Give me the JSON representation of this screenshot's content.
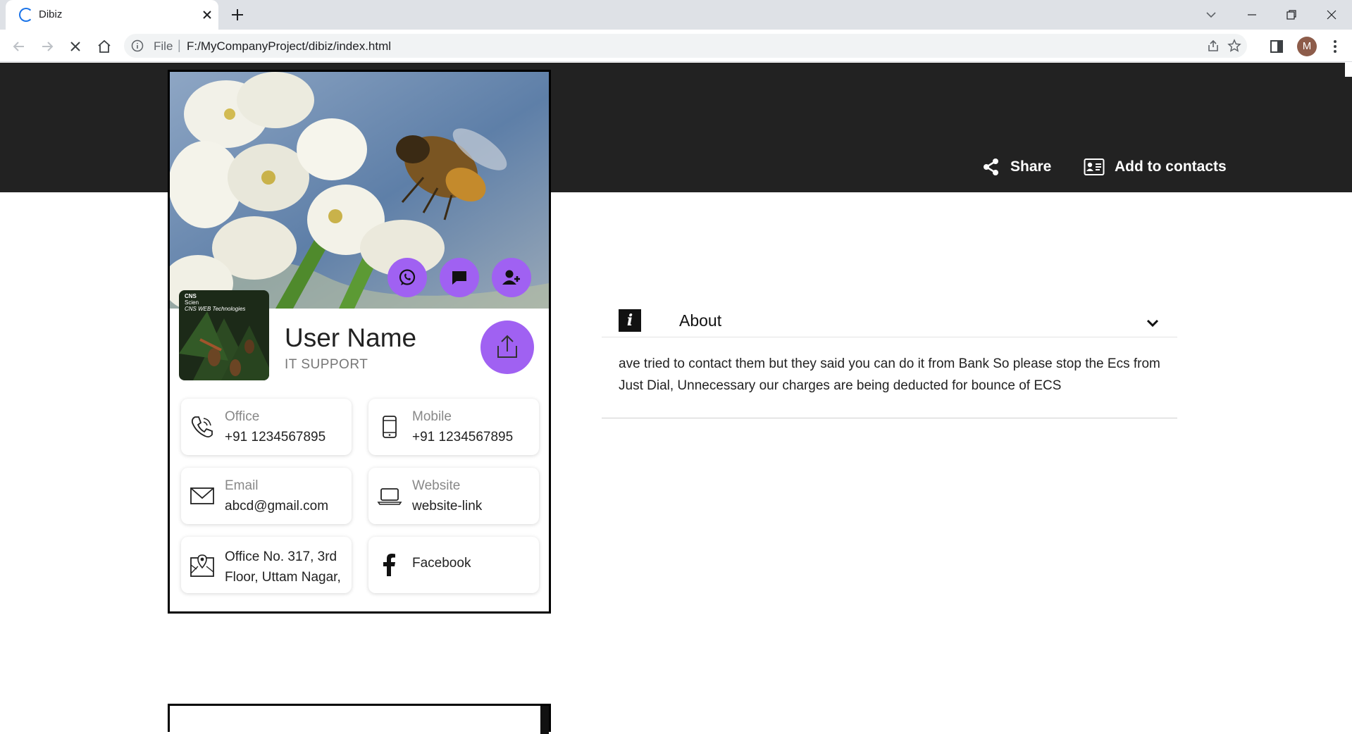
{
  "browser": {
    "tab_title": "Dibiz",
    "file_label": "File",
    "url": "F:/MyCompanyProject/dibiz/index.html",
    "profile_initial": "M"
  },
  "header": {
    "share_label": "Share",
    "add_contacts_label": "Add to contacts"
  },
  "card": {
    "logo_text": [
      "CNS",
      "Scien",
      "CNS WEB Technologies"
    ],
    "user_name": "User Name",
    "user_role": "IT SUPPORT",
    "quick_actions": [
      "whatsapp-icon",
      "message-icon",
      "add-contact-icon"
    ],
    "office": {
      "label": "Office",
      "value": "+91 1234567895"
    },
    "mobile": {
      "label": "Mobile",
      "value": "+91 1234567895"
    },
    "email": {
      "label": "Email",
      "value": "abcd@gmail.com"
    },
    "website": {
      "label": "Website",
      "value": "website-link"
    },
    "address": "Office No. 317, 3rd Floor, Uttam Nagar,",
    "facebook": "Facebook"
  },
  "about": {
    "title": "About",
    "body": "ave tried to contact them but they said you can do it from Bank So please stop the Ecs from Just Dial, Unnecessary our charges are being deducted for bounce of ECS"
  },
  "colors": {
    "accent": "#a061f2",
    "header_bg": "#222222"
  }
}
